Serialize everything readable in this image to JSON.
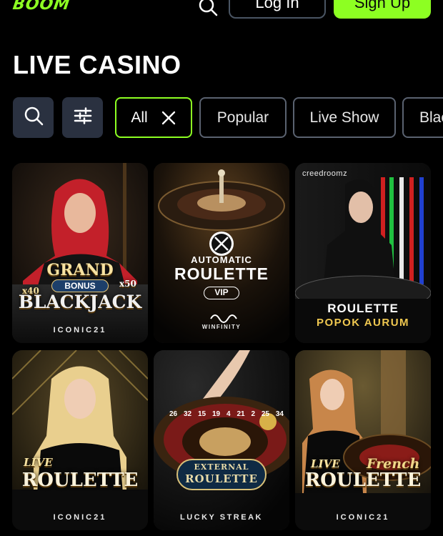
{
  "header": {
    "logo": "BOOM",
    "login_label": "Log In",
    "signup_label": "Sign Up"
  },
  "page_title": "LIVE CASINO",
  "filters": {
    "chips": [
      {
        "label": "All",
        "active": true
      },
      {
        "label": "Popular",
        "active": false
      },
      {
        "label": "Live Show",
        "active": false
      },
      {
        "label": "Blac",
        "active": false
      }
    ]
  },
  "games": [
    {
      "multiplier_left": "x40",
      "line1": "GRAND",
      "badge": "BONUS",
      "multiplier_right": "x50",
      "title": "BLACKJACK",
      "provider": "ICONIC21"
    },
    {
      "line1": "AUTOMATIC",
      "title": "ROULETTE",
      "badge": "VIP",
      "provider": "WINFINITY"
    },
    {
      "provider": "creedroomz",
      "title": "ROULETTE",
      "subtitle": "POPOK AURUM"
    },
    {
      "line1": "LIVE",
      "title": "ROULETTE",
      "provider": "ICONIC21"
    },
    {
      "line1": "EXTERNAL",
      "title": "ROULETTE",
      "provider": "LUCKY STREAK",
      "wheel_numbers": [
        "26",
        "32",
        "15",
        "19",
        "4",
        "21",
        "2",
        "25",
        "34"
      ]
    },
    {
      "line1": "LIVE",
      "title": "ROULETTE",
      "script": "French",
      "provider": "ICONIC21"
    }
  ],
  "colors": {
    "accent": "#8dff22",
    "chip_border": "#5a6270",
    "icon_button_bg": "#2a3140"
  }
}
